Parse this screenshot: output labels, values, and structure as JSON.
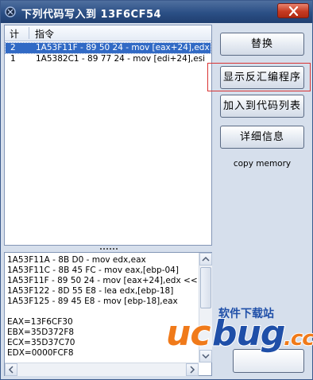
{
  "window": {
    "title": "下列代码写入到 13F6CF54"
  },
  "listview": {
    "columns": [
      "计",
      "指令"
    ],
    "rows": [
      {
        "index": "2",
        "text": "1A53F11F - 89 50 24  - mov [eax+24],edx",
        "selected": true
      },
      {
        "index": "1",
        "text": "1A5382C1 - 89 77 24  - mov [edi+24],esi",
        "selected": false
      }
    ]
  },
  "disassembly": {
    "lines": [
      "1A53F11A - 8B D0  - mov edx,eax",
      "1A53F11C - 8B 45 FC  - mov eax,[ebp-04]",
      "1A53F11F - 89 50 24  - mov [eax+24],edx <<",
      "1A53F122 - 8D 55 E8  - lea edx,[ebp-18]",
      "1A53F125 - 89 45 E8  - mov [ebp-18],eax",
      "",
      "EAX=13F6CF30",
      "EBX=35D372F8",
      "ECX=35D37C70",
      "EDX=0000FCF8"
    ]
  },
  "buttons": {
    "replace": "替换",
    "show_disassembler": "显示反汇编程序",
    "add_to_codelist": "加入到代码列表",
    "details": "详细信息"
  },
  "copy_memory_label": "copy memory",
  "watermark": {
    "logo_text": "ucbug.cc",
    "tagline": "软件下载站"
  },
  "colors": {
    "title_bar": "#2b4f85",
    "selection": "#316ac5",
    "highlight": "#d93333",
    "watermark_orange": "#f07a1a",
    "watermark_blue": "#1f4fa8"
  }
}
